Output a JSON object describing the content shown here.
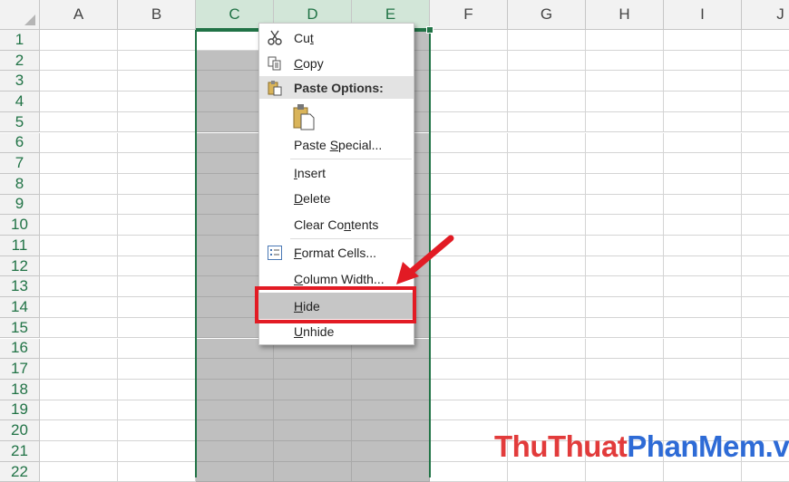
{
  "columns": [
    "A",
    "B",
    "C",
    "D",
    "E",
    "F",
    "G",
    "H",
    "I",
    "J"
  ],
  "rows": [
    "1",
    "2",
    "3",
    "4",
    "5",
    "6",
    "7",
    "8",
    "9",
    "10",
    "11",
    "12",
    "13",
    "14",
    "15",
    "16",
    "17",
    "18",
    "19",
    "20",
    "21",
    "22"
  ],
  "context_menu": {
    "cut": {
      "pre": "Cu",
      "key": "t",
      "post": ""
    },
    "copy": {
      "pre": "",
      "key": "C",
      "post": "opy"
    },
    "paste_options": "Paste Options:",
    "paste_special": {
      "pre": "Paste ",
      "key": "S",
      "post": "pecial..."
    },
    "insert": {
      "pre": "",
      "key": "I",
      "post": "nsert"
    },
    "delete": {
      "pre": "",
      "key": "D",
      "post": "elete"
    },
    "clear_contents": {
      "pre": "Clear Co",
      "key": "n",
      "post": "tents"
    },
    "format_cells": {
      "pre": "",
      "key": "F",
      "post": "ormat Cells..."
    },
    "column_width": {
      "pre": "",
      "key": "C",
      "post": "olumn Width..."
    },
    "hide": {
      "pre": "",
      "key": "H",
      "post": "ide"
    },
    "unhide": {
      "pre": "",
      "key": "U",
      "post": "nhide"
    }
  },
  "watermark": {
    "part1": "ThuThuat",
    "part2": "PhanMem.vn"
  },
  "colors": {
    "excel_green": "#217346",
    "highlight_red": "#e21b24",
    "selected_column_fill": "#bfbfbf"
  }
}
